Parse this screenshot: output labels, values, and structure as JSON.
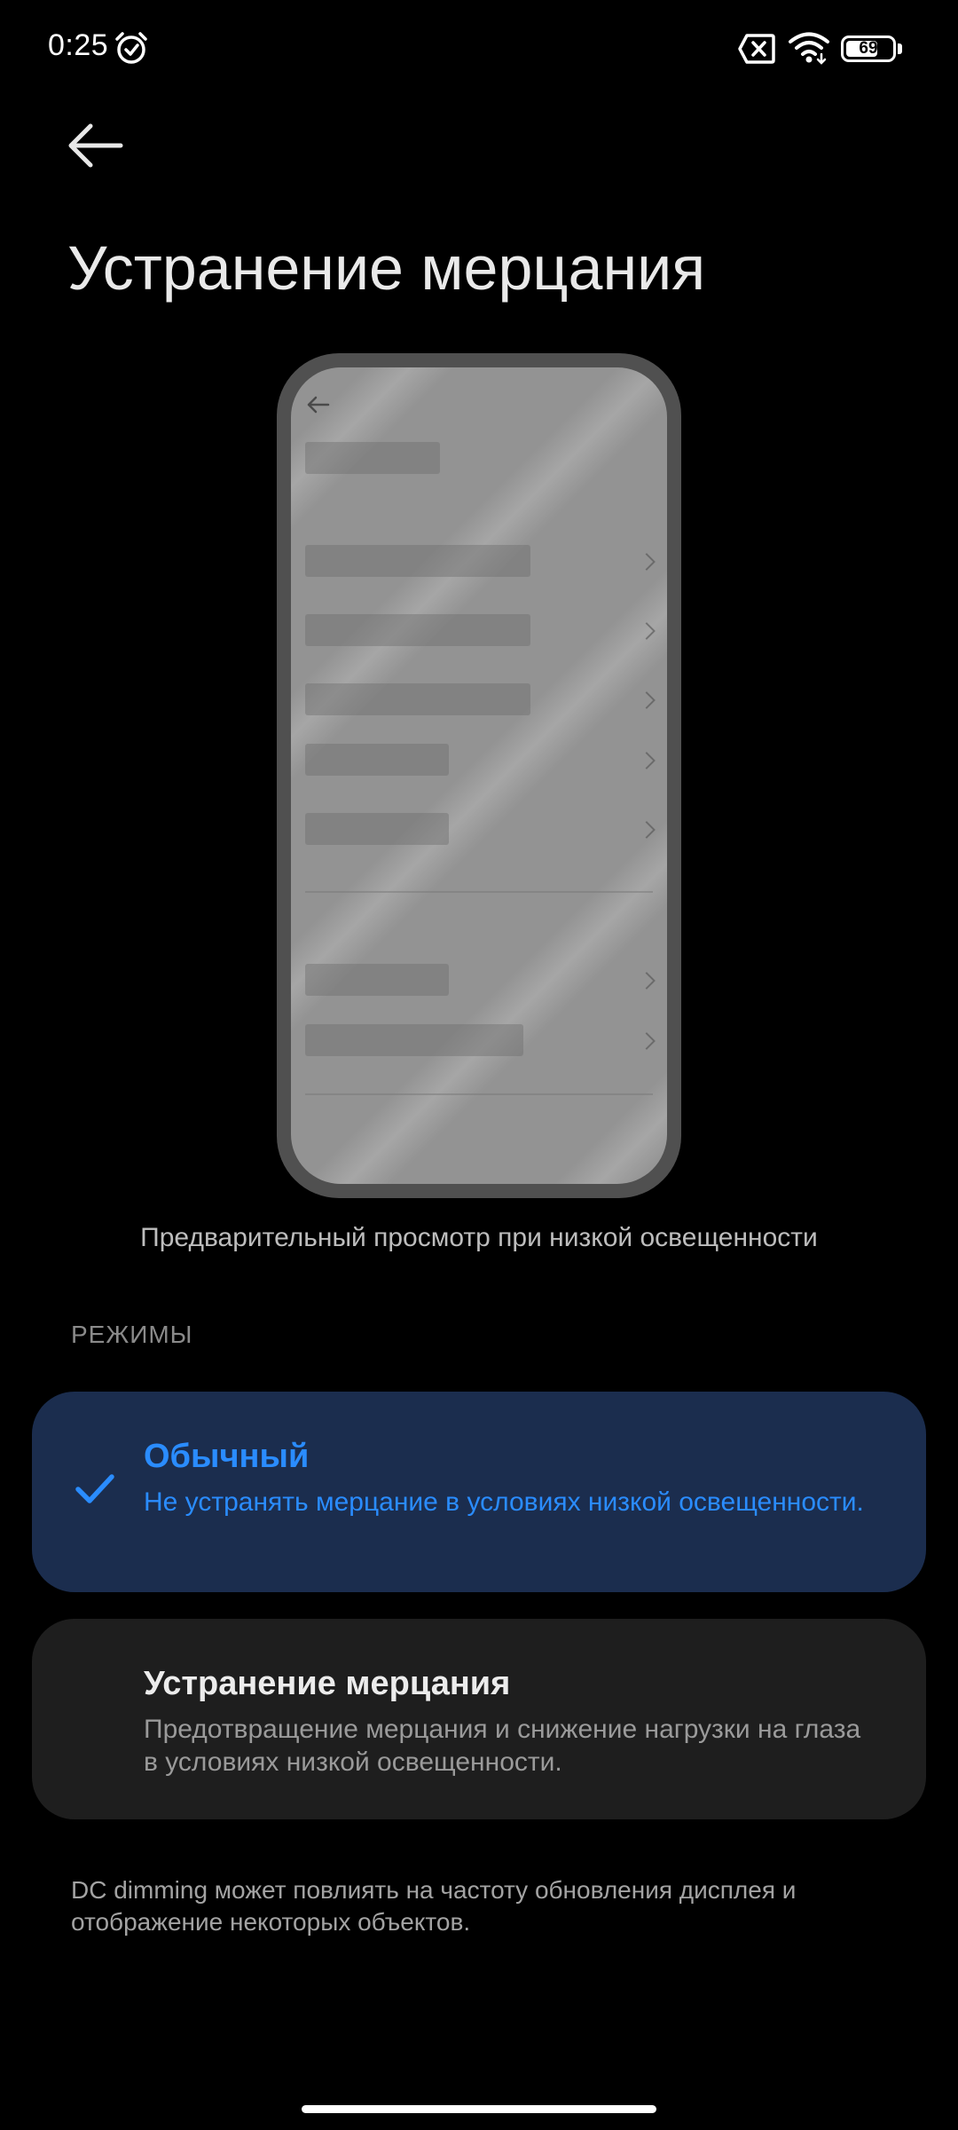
{
  "status_bar": {
    "time": "0:25",
    "battery_level": "69",
    "icons": [
      "alarm-icon",
      "sim-off-icon",
      "wifi-icon",
      "battery-icon"
    ]
  },
  "header": {
    "back_icon": "arrow-left-icon",
    "title": "Устранение мерцания"
  },
  "preview": {
    "caption": "Предварительный просмотр при низкой освещенности"
  },
  "modes": {
    "section_label": "РЕЖИМЫ",
    "items": [
      {
        "title": "Обычный",
        "description": "Не устранять мерцание в условиях низкой освещенности.",
        "selected": true
      },
      {
        "title": "Устранение мерцания",
        "description": "Предотвращение мерцания и снижение нагрузки на глаза в условиях низкой освещенности.",
        "selected": false
      }
    ]
  },
  "footer": {
    "note": "DC dimming может повлиять на частоту обновления дисплея и отображение некоторых объектов."
  },
  "colors": {
    "background": "#000000",
    "accent": "#2a8cff",
    "selected_card": "#1b2d4e",
    "card": "#1e1e1e"
  }
}
